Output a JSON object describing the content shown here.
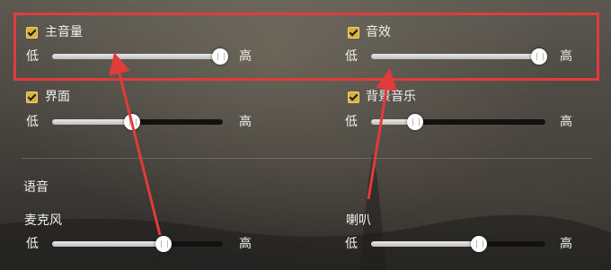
{
  "colors": {
    "accent_checkbox": "#d9b03a",
    "slider_fill": "#d8d8d8",
    "slider_track": "#121212",
    "highlight": "#e23b3b"
  },
  "settings": {
    "master_volume": {
      "label": "主音量",
      "checked": true,
      "low": "低",
      "high": "高",
      "value": 1.0
    },
    "sound_effects": {
      "label": "音效",
      "checked": true,
      "low": "低",
      "high": "高",
      "value": 1.0
    },
    "interface": {
      "label": "界面",
      "checked": true,
      "low": "低",
      "high": "高",
      "value": 0.47
    },
    "background_music": {
      "label": "背景音乐",
      "checked": true,
      "low": "低",
      "high": "高",
      "value": 0.25
    }
  },
  "voice": {
    "section_title": "语音",
    "microphone": {
      "label": "麦克风",
      "low": "低",
      "high": "高",
      "value": 0.65
    },
    "speaker": {
      "label": "喇叭",
      "low": "低",
      "high": "高",
      "value": 0.62
    }
  },
  "annotation": {
    "icon": "red-highlight-box-with-arrows"
  }
}
